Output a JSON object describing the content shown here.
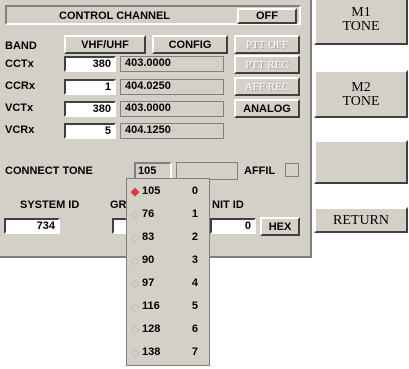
{
  "header": {
    "title": "CONTROL CHANNEL",
    "off_label": "OFF"
  },
  "band": {
    "label": "BAND",
    "value": "VHF/UHF",
    "config_label": "CONFIG",
    "ptt_off_label": "PTT OFF"
  },
  "rows": [
    {
      "label": "CCTx",
      "ch": "380",
      "freq": "403.0000"
    },
    {
      "label": "CCRx",
      "ch": "1",
      "freq": "404.0250"
    },
    {
      "label": "VCTx",
      "ch": "380",
      "freq": "403.0000"
    },
    {
      "label": "VCRx",
      "ch": "5",
      "freq": "404.1250"
    }
  ],
  "side_buttons": {
    "ptt_rec": "PTT REC",
    "aff_rec": "AFF REC",
    "analog": "ANALOG"
  },
  "connect_tone": {
    "label": "CONNECT TONE",
    "value": "105",
    "affil_label": "AFFIL"
  },
  "ids": {
    "system_id_label": "SYSTEM ID",
    "system_id": "734",
    "group_label": "GR",
    "unit_label": "NIT ID",
    "unit_value": "0",
    "hex_label": "HEX"
  },
  "right_panel": {
    "m1_line1": "M1",
    "m1_line2": "TONE",
    "m2_line1": "M2",
    "m2_line2": "TONE",
    "return_label": "RETURN"
  },
  "dropdown": {
    "items": [
      {
        "value": "105",
        "index": "0",
        "selected": true
      },
      {
        "value": "76",
        "index": "1",
        "selected": false
      },
      {
        "value": "83",
        "index": "2",
        "selected": false
      },
      {
        "value": "90",
        "index": "3",
        "selected": false
      },
      {
        "value": "97",
        "index": "4",
        "selected": false
      },
      {
        "value": "116",
        "index": "5",
        "selected": false
      },
      {
        "value": "128",
        "index": "6",
        "selected": false
      },
      {
        "value": "138",
        "index": "7",
        "selected": false
      }
    ]
  }
}
